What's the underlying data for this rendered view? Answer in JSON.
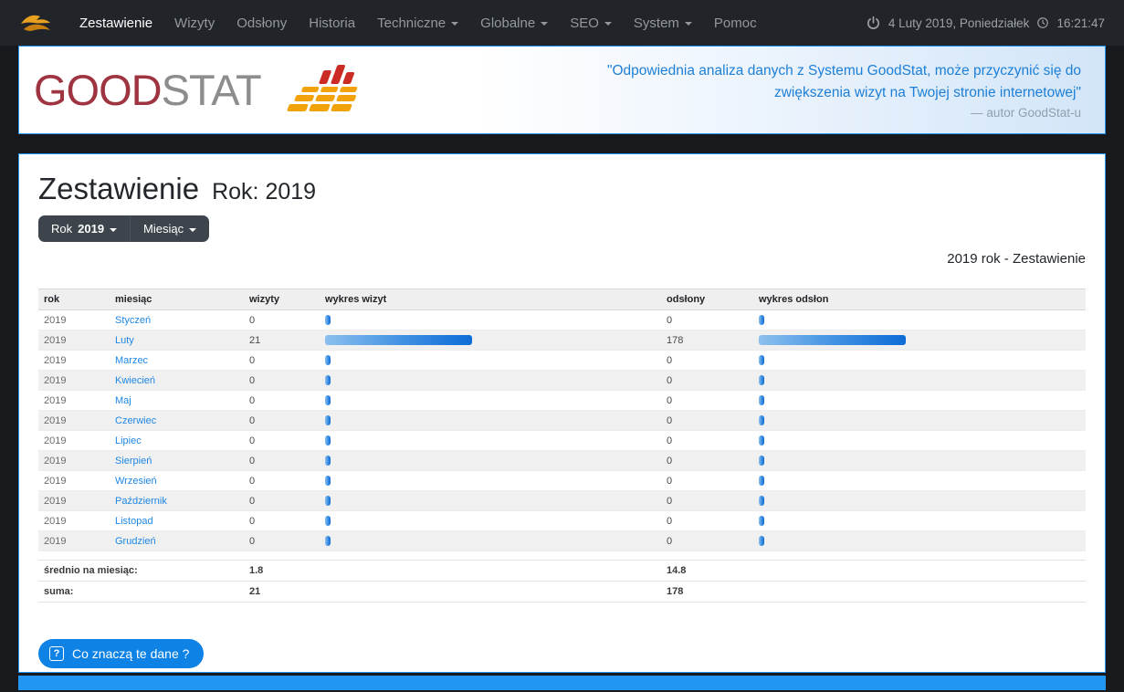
{
  "navbar": {
    "items": [
      {
        "label": "Zestawienie",
        "active": true,
        "caret": false
      },
      {
        "label": "Wizyty",
        "active": false,
        "caret": false
      },
      {
        "label": "Odsłony",
        "active": false,
        "caret": false
      },
      {
        "label": "Historia",
        "active": false,
        "caret": false
      },
      {
        "label": "Techniczne",
        "active": false,
        "caret": true
      },
      {
        "label": "Globalne",
        "active": false,
        "caret": true
      },
      {
        "label": "SEO",
        "active": false,
        "caret": true
      },
      {
        "label": "System",
        "active": false,
        "caret": true
      },
      {
        "label": "Pomoc",
        "active": false,
        "caret": false
      }
    ],
    "datetime": "4 Luty 2019, Poniedziałek",
    "time": "16:21:47"
  },
  "header": {
    "logo_good": "GOOD",
    "logo_stat": "STAT",
    "quote_line1": "\"Odpowiednia analiza danych z Systemu GoodStat, może przyczynić się do",
    "quote_line2": "zwiększenia wizyt na Twojej stronie internetowej\"",
    "quote_author": "— autor GoodStat-u"
  },
  "main": {
    "title": "Zestawienie",
    "subtitle": "Rok: 2019",
    "filters": {
      "rok_label": "Rok",
      "rok_value": "2019",
      "miesiac_label": "Miesiąc"
    },
    "caption": "2019 rok - Zestawienie",
    "table": {
      "headers": [
        "rok",
        "miesiąc",
        "wizyty",
        "wykres wizyt",
        "odsłony",
        "wykres odsłon"
      ],
      "rows": [
        {
          "rok": "2019",
          "miesiac": "Styczeń",
          "wizyty": 0,
          "odslony": 0
        },
        {
          "rok": "2019",
          "miesiac": "Luty",
          "wizyty": 21,
          "odslony": 178
        },
        {
          "rok": "2019",
          "miesiac": "Marzec",
          "wizyty": 0,
          "odslony": 0
        },
        {
          "rok": "2019",
          "miesiac": "Kwiecień",
          "wizyty": 0,
          "odslony": 0
        },
        {
          "rok": "2019",
          "miesiac": "Maj",
          "wizyty": 0,
          "odslony": 0
        },
        {
          "rok": "2019",
          "miesiac": "Czerwiec",
          "wizyty": 0,
          "odslony": 0
        },
        {
          "rok": "2019",
          "miesiac": "Lipiec",
          "wizyty": 0,
          "odslony": 0
        },
        {
          "rok": "2019",
          "miesiac": "Sierpień",
          "wizyty": 0,
          "odslony": 0
        },
        {
          "rok": "2019",
          "miesiac": "Wrzesień",
          "wizyty": 0,
          "odslony": 0
        },
        {
          "rok": "2019",
          "miesiac": "Październik",
          "wizyty": 0,
          "odslony": 0
        },
        {
          "rok": "2019",
          "miesiac": "Listopad",
          "wizyty": 0,
          "odslony": 0
        },
        {
          "rok": "2019",
          "miesiac": "Grudzień",
          "wizyty": 0,
          "odslony": 0
        }
      ],
      "summary": [
        {
          "label": "średnio na miesiąc:",
          "wizyty": "1.8",
          "odslony": "14.8"
        },
        {
          "label": "suma:",
          "wizyty": "21",
          "odslony": "178"
        }
      ]
    },
    "help_button": "Co znaczą te dane ?"
  },
  "colors": {
    "accent_blue": "#2196f3",
    "bar_gradient_start": "#8cc0ee",
    "bar_gradient_end": "#0e6cd6",
    "logo_red": "#9e3440",
    "logo_gray": "#8d8d8d",
    "button_blue": "#0f82e6",
    "navbar_bg": "#212529"
  }
}
